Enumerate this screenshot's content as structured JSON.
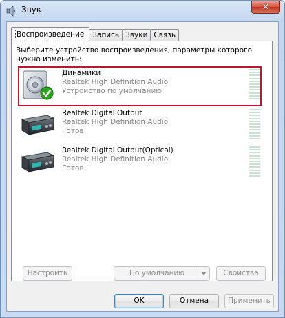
{
  "window": {
    "title": "Звук",
    "close_label": "✕"
  },
  "tabs": [
    {
      "label": "Воспроизведение",
      "active": true
    },
    {
      "label": "Запись",
      "active": false
    },
    {
      "label": "Звуки",
      "active": false
    },
    {
      "label": "Связь",
      "active": false
    }
  ],
  "instruction": "Выберите устройство воспроизведения, параметры которого нужно изменить:",
  "devices": [
    {
      "name": "Динамики",
      "driver": "Realtek High Definition Audio",
      "status": "Устройство по умолчанию",
      "icon": "speaker-icon",
      "selected": true
    },
    {
      "name": "Realtek Digital Output",
      "driver": "Realtek High Definition Audio",
      "status": "Готов",
      "icon": "digital-output-icon",
      "selected": false
    },
    {
      "name": "Realtek Digital Output(Optical)",
      "driver": "Realtek High Definition Audio",
      "status": "Готов",
      "icon": "digital-output-optical-icon",
      "selected": false
    }
  ],
  "panel_buttons": {
    "configure": "Настроить",
    "default": "По умолчанию",
    "properties": "Свойства"
  },
  "dialog_buttons": {
    "ok": "OK",
    "cancel": "Отмена",
    "apply": "Применить"
  },
  "colors": {
    "selection_border": "#c5132b",
    "check_green": "#2aa31e",
    "meter_segment": "#c9e0d3"
  }
}
